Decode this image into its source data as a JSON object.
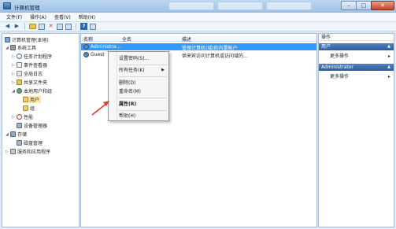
{
  "window": {
    "title": "计算机管理"
  },
  "window_controls": {
    "minimize": "–",
    "maximize": "□",
    "close": "✕"
  },
  "menu": [
    "文件(F)",
    "操作(A)",
    "查看(V)",
    "帮助(H)"
  ],
  "toolbar": [
    "back-icon",
    "forward-icon",
    "up-folder-icon",
    "show-hide-tree-icon",
    "delete-icon",
    "properties-icon",
    "export-icon",
    "help-icon",
    "view-icon"
  ],
  "tree": {
    "root": "计算机管理(本地)",
    "system_tools": "系统工具",
    "task_scheduler": "任务计划程序",
    "event_viewer": "事件查看器",
    "global_log": "全局日志",
    "shared_folders": "共享文件夹",
    "local_users_groups": "本地用户和组",
    "users": "用户",
    "groups": "组",
    "performance": "性能",
    "device_manager": "设备管理器",
    "storage": "存储",
    "disk_management": "磁盘管理",
    "services_apps": "服务和应用程序"
  },
  "list": {
    "columns": [
      "名称",
      "全名",
      "描述"
    ],
    "rows": [
      {
        "name": "Administra...",
        "fullname": "",
        "description": "管理计算机(域)的内置帐户"
      },
      {
        "name": "Guest",
        "fullname": "",
        "description": "供来宾访问计算机或访问域的..."
      }
    ]
  },
  "context_menu": {
    "set_password": "设置密码(S)...",
    "all_tasks": "所有任务(K)",
    "delete": "删除(D)",
    "rename": "重命名(M)",
    "properties": "属性(R)",
    "help": "帮助(H)"
  },
  "actions": {
    "header": "操作",
    "section1": "用户",
    "more1": "更多操作",
    "section2": "Administrator",
    "more2": "更多操作"
  },
  "colors": {
    "selection": "#3399ff",
    "annotation_arrow": "#e03a2c",
    "section_header": "#3f72b0"
  }
}
